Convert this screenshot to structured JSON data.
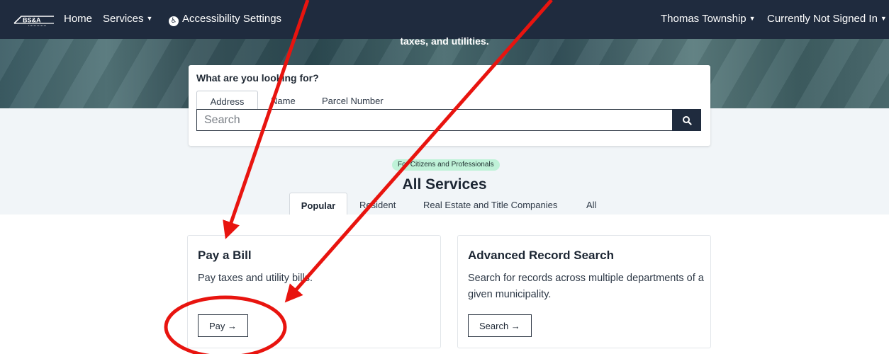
{
  "nav": {
    "brand": "BS&A",
    "home": "Home",
    "services": "Services",
    "accessibility": "Accessibility Settings",
    "township": "Thomas Township",
    "signin": "Currently Not Signed In"
  },
  "hero": {
    "subtitle": "taxes, and utilities."
  },
  "search": {
    "question": "What are you looking for?",
    "tabs": [
      "Address",
      "Name",
      "Parcel Number"
    ],
    "active_tab": "Address",
    "placeholder": "Search",
    "button_icon": "search-icon"
  },
  "services": {
    "badge": "For Citizens and Professionals",
    "title": "All Services",
    "tabs": [
      "Popular",
      "Resident",
      "Real Estate and Title Companies",
      "All"
    ],
    "active_tab": "Popular"
  },
  "cards": [
    {
      "title": "Pay a Bill",
      "description": "Pay taxes and utility bills.",
      "button": "Pay →"
    },
    {
      "title": "Advanced Record Search",
      "description": "Search for records across multiple departments of a given municipality.",
      "button": "Search →"
    }
  ],
  "colors": {
    "nav_bg": "#1f2b3e",
    "badge_bg": "#bff2d8",
    "annotation": "#e8140f"
  }
}
